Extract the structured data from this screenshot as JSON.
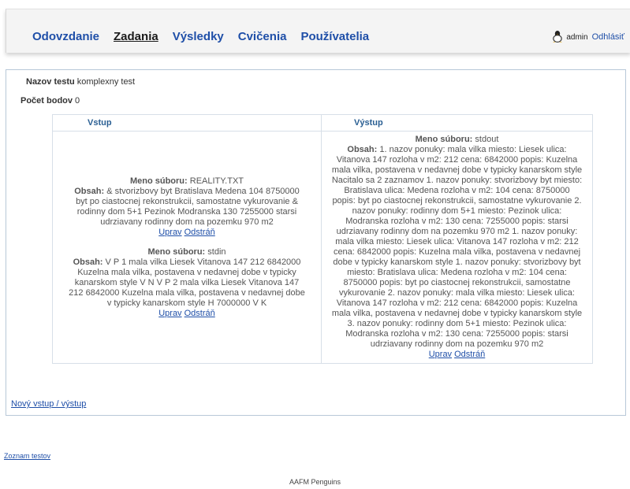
{
  "nav": {
    "items": [
      {
        "label": "Odovzdanie"
      },
      {
        "label": "Zadania"
      },
      {
        "label": "Výsledky"
      },
      {
        "label": "Cvičenia"
      },
      {
        "label": "Používatelia"
      }
    ],
    "active": "Zadania"
  },
  "user": {
    "icon": "user-icon",
    "name": "admin",
    "logout_label": "Odhlásiť"
  },
  "test": {
    "name_label": "Nazov testu",
    "name_value": "komplexny test",
    "points_label": "Počet bodov",
    "points_value": "0"
  },
  "table": {
    "headers": {
      "input": "Vstup",
      "output": "Výstup"
    },
    "input_files": [
      {
        "file_label": "Meno súboru:",
        "file_name": "REALITY.TXT",
        "content_label": "Obsah:",
        "content": "& stvorizbovy byt Bratislava Medena 104 8750000 byt po ciastocnej rekonstrukcii, samostatne vykurovanie & rodinny dom 5+1 Pezinok Modranska 130 7255000 starsi udrziavany rodinny dom na pozemku 970 m2",
        "edit_label": "Uprav",
        "delete_label": "Odstráň"
      },
      {
        "file_label": "Meno súboru:",
        "file_name": "stdin",
        "content_label": "Obsah:",
        "content": "V P 1 mala vilka Liesek Vitanova 147 212 6842000 Kuzelna mala vilka, postavena v nedavnej dobe v typicky kanarskom style V N V P 2 mala vilka Liesek Vitanova 147 212 6842000 Kuzelna mala vilka, postavena v nedavnej dobe v typicky kanarskom style H 7000000 V K",
        "edit_label": "Uprav",
        "delete_label": "Odstráň"
      }
    ],
    "output_files": [
      {
        "file_label": "Meno súboru:",
        "file_name": "stdout",
        "content_label": "Obsah:",
        "content": "1. nazov ponuky: mala vilka miesto: Liesek ulica: Vitanova 147 rozloha v m2: 212 cena: 6842000 popis: Kuzelna mala vilka, postavena v nedavnej dobe v typicky kanarskom style Nacitalo sa 2 zaznamov 1. nazov ponuky: stvorizbovy byt miesto: Bratislava ulica: Medena rozloha v m2: 104 cena: 8750000 popis: byt po ciastocnej rekonstrukcii, samostatne vykurovanie 2. nazov ponuky: rodinny dom 5+1 miesto: Pezinok ulica: Modranska rozloha v m2: 130 cena: 7255000 popis: starsi udrziavany rodinny dom na pozemku 970 m2 1. nazov ponuky: mala vilka miesto: Liesek ulica: Vitanova 147 rozloha v m2: 212 cena: 6842000 popis: Kuzelna mala vilka, postavena v nedavnej dobe v typicky kanarskom style 1. nazov ponuky: stvorizbovy byt miesto: Bratislava ulica: Medena rozloha v m2: 104 cena: 8750000 popis: byt po ciastocnej rekonstrukcii, samostatne vykurovanie 2. nazov ponuky: mala vilka miesto: Liesek ulica: Vitanova 147 rozloha v m2: 212 cena: 6842000 popis: Kuzelna mala vilka, postavena v nedavnej dobe v typicky kanarskom style 3. nazov ponuky: rodinny dom 5+1 miesto: Pezinok ulica: Modranska rozloha v m2: 130 cena: 7255000 popis: starsi udrziavany rodinny dom na pozemku 970 m2",
        "edit_label": "Uprav",
        "delete_label": "Odstráň"
      }
    ]
  },
  "links": {
    "new_io": "Nový vstup / výstup",
    "test_list": "Zoznam testov"
  },
  "footer": {
    "text": "AAFM Penguins"
  }
}
